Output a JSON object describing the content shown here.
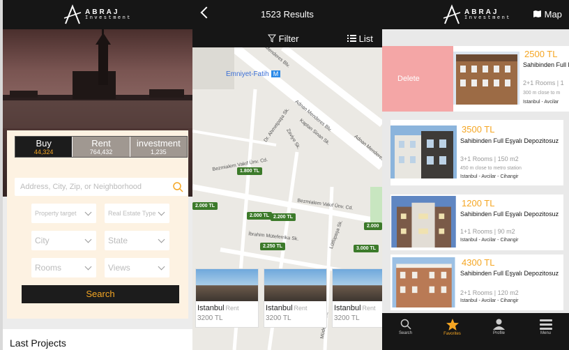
{
  "brand": {
    "name": "ABRAJ",
    "tagline": "Investment"
  },
  "home": {
    "tabs": [
      {
        "label": "Buy",
        "count": "44,324"
      },
      {
        "label": "Rent",
        "count": "764,432"
      },
      {
        "label": "investment",
        "count": "1,235"
      }
    ],
    "address_placeholder": "Address, City, Zip, or Neighborhood",
    "filters": [
      {
        "label": "Property target"
      },
      {
        "label": "Real Estate Type"
      },
      {
        "label": "City"
      },
      {
        "label": "State"
      },
      {
        "label": "Rooms"
      },
      {
        "label": "Views"
      }
    ],
    "search_label": "Search",
    "last_projects_label": "Last Projects"
  },
  "map_screen": {
    "results_label": "1523 Results",
    "filter_label": "Filter",
    "list_label": "List",
    "metro_label": "Emniyet-Fatih",
    "metro_badge": "M",
    "streets": [
      "Adnan Menderes Blv.",
      "Adnan Menderes Blv.",
      "Dr. Ahmetpaşa Sk.",
      "Kaptan Sinan Sk.",
      "Zaviye Sk.",
      "Bezmialem Vakıf Ünv. Cd.",
      "Bezmialem Vakıf Ünv. Cd.",
      "İbrahim Müteferrika Sk.",
      "Lütfüpaşa Sk.",
      "Müderris Sk."
    ],
    "pins": [
      "1.800 TL",
      "2.000 TL",
      "2.000 TL",
      "2.200 TL",
      "2.250 TL",
      "3.000 TL",
      "2.000"
    ],
    "cards": [
      {
        "city": "Istanbul",
        "type": "Rent",
        "price": "3200 TL"
      },
      {
        "city": "Istanbul",
        "type": "Rent",
        "price": "3200 TL"
      },
      {
        "city": "Istanbul",
        "type": "Rent",
        "price": "3200 TL"
      }
    ]
  },
  "favorites": {
    "map_label": "Map",
    "delete_label": "Delete",
    "listings": [
      {
        "price": "2500 TL",
        "title": "Sahibinden Full Depozitosuz",
        "meta": "2+1 Rooms | 1",
        "metro": "300 m close to m",
        "location": "Istanbul - Avcilar"
      },
      {
        "price": "3500 TL",
        "title": "Sahibinden Full Eşyalı Depozitosuz",
        "meta": "3+1 Rooms | 150 m2",
        "metro": "450 m close to metro station",
        "location": "Istanbul - Avcilar - Cihangir"
      },
      {
        "price": "1200 TL",
        "title": "Sahibinden Full Eşyalı Depozitosuz",
        "meta": "1+1 Rooms | 90 m2",
        "metro": "",
        "location": "Istanbul - Avcilar - Cihangir"
      },
      {
        "price": "4300 TL",
        "title": "Sahibinden Full Eşyalı Depozitosuz",
        "meta": "2+1 Rooms | 120 m2",
        "metro": "",
        "location": "Istanbul - Avcilar - Cihangir"
      }
    ],
    "tabbar": [
      {
        "label": "Search",
        "icon": "search-icon"
      },
      {
        "label": "Favorites",
        "icon": "star-icon"
      },
      {
        "label": "Profile",
        "icon": "profile-icon"
      },
      {
        "label": "Menu",
        "icon": "menu-icon"
      }
    ]
  },
  "colors": {
    "accent": "#f5a623",
    "dark": "#161616",
    "pin": "#3c7a2a",
    "delete": "#f4a6a6"
  }
}
